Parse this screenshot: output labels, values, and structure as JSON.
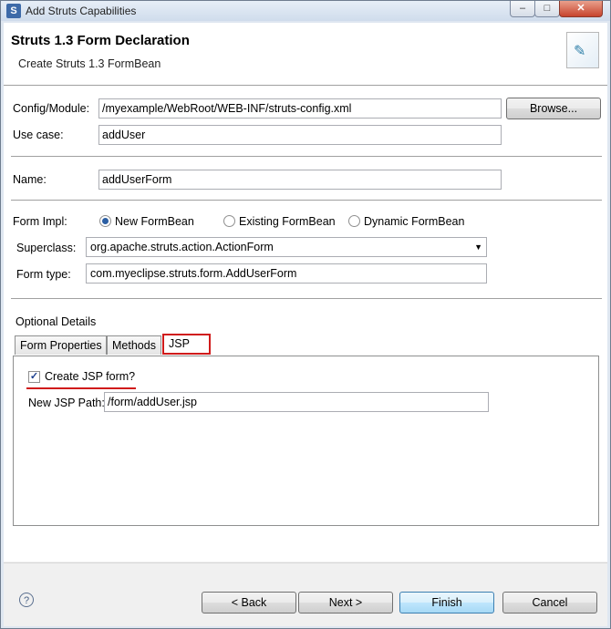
{
  "window": {
    "title": "Add Struts Capabilities"
  },
  "header": {
    "title": "Struts 1.3 Form Declaration",
    "subtitle": "Create Struts 1.3 FormBean"
  },
  "form": {
    "config_label": "Config/Module:",
    "config_value": "/myexample/WebRoot/WEB-INF/struts-config.xml",
    "browse_label": "Browse...",
    "usecase_label": "Use case:",
    "usecase_value": "addUser",
    "name_label": "Name:",
    "name_value": "addUserForm",
    "impl_label": "Form Impl:",
    "impl_options": [
      {
        "label": "New FormBean",
        "selected": true
      },
      {
        "label": "Existing FormBean",
        "selected": false
      },
      {
        "label": "Dynamic FormBean",
        "selected": false
      }
    ],
    "superclass_label": "Superclass:",
    "superclass_value": "org.apache.struts.action.ActionForm",
    "formtype_label": "Form type:",
    "formtype_value": "com.myeclipse.struts.form.AddUserForm"
  },
  "optional": {
    "label": "Optional Details",
    "tabs": [
      {
        "label": "Form Properties",
        "active": false
      },
      {
        "label": "Methods",
        "active": false
      },
      {
        "label": "JSP",
        "active": true
      }
    ],
    "create_jsp_label": "Create JSP form?",
    "create_jsp_checked": true,
    "jsp_path_label": "New JSP Path:",
    "jsp_path_value": "/form/addUser.jsp"
  },
  "footer": {
    "back_label": "< Back",
    "next_label": "Next >",
    "finish_label": "Finish",
    "cancel_label": "Cancel"
  },
  "icons": {
    "help": "help-icon",
    "app": "struts-app-icon",
    "combo": "chevron-down-icon"
  },
  "colors": {
    "highlight": "#d01b1b",
    "radio_selected": "#2c5fa3"
  }
}
